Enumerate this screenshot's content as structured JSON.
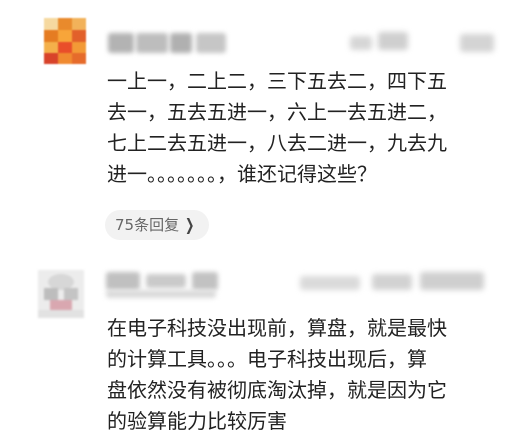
{
  "comments": [
    {
      "author_name": "",
      "lines": [
        "一上一，二上二，三下五去二，四下五",
        "去一，五去五进一，六上一去五进二，",
        "七上二去五进一，八去二进一，九去九",
        "进一。。。。。。。，谁还记得这些？"
      ],
      "reply_count_label": "75条回复",
      "reply_icon": "chevron-right-icon"
    },
    {
      "author_name": "",
      "lines": [
        "在电子科技没出现前，算盘，就是最快",
        "的计算工具。。。电子科技出现后，算",
        "盘依然没有被彻底淘汰掉，就是因为它",
        "的验算能力比较厉害"
      ]
    }
  ],
  "colors": {
    "text": "#222222",
    "reply_pill_bg": "#f2f2f2",
    "reply_pill_text": "#666666"
  }
}
